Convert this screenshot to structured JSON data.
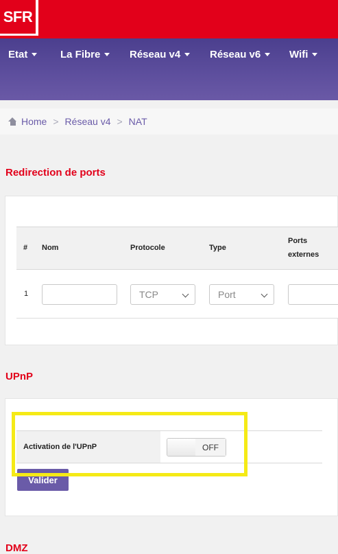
{
  "header": {
    "logo": "SFR"
  },
  "nav": {
    "items": [
      {
        "label": "Etat"
      },
      {
        "label": "La Fibre"
      },
      {
        "label": "Réseau v4"
      },
      {
        "label": "Réseau v6"
      },
      {
        "label": "Wifi"
      }
    ]
  },
  "breadcrumb": {
    "home": "Home",
    "level1": "Réseau v4",
    "level2": "NAT"
  },
  "port_redirect": {
    "title": "Redirection de ports",
    "headers": {
      "num": "#",
      "nom": "Nom",
      "protocole": "Protocole",
      "type": "Type",
      "ports_line1": "Ports",
      "ports_line2": "externes"
    },
    "row": {
      "num": "1",
      "nom_value": "",
      "protocole": "TCP",
      "type": "Port",
      "ports_value": ""
    }
  },
  "upnp": {
    "title": "UPnP",
    "label": "Activation de l'UPnP",
    "toggle_state": "OFF",
    "submit": "Valider"
  },
  "dmz": {
    "title": "DMZ"
  },
  "colors": {
    "brand_red": "#e2001a",
    "nav_purple": "#5e4f9e",
    "highlight": "#f5ea16"
  }
}
